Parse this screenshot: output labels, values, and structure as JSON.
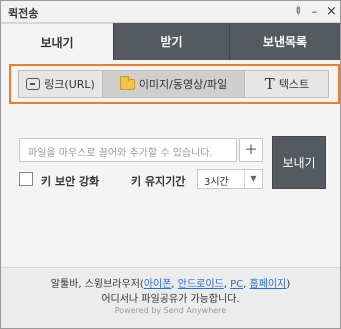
{
  "window": {
    "title": "퀵전송"
  },
  "tabs": [
    {
      "label": "보내기",
      "active": true
    },
    {
      "label": "받기",
      "active": false
    },
    {
      "label": "보낸목록",
      "active": false
    }
  ],
  "modes": [
    {
      "label": "링크(URL)",
      "icon": "link-icon",
      "selected": false
    },
    {
      "label": "이미지/동영상/파일",
      "icon": "folder-icon",
      "selected": true
    },
    {
      "label": "텍스트",
      "icon": "text-icon",
      "selected": false
    }
  ],
  "mode_highlight_color": "#f47a2e",
  "drop": {
    "placeholder": "파일을 마우스로 끌어와 추가할 수 있습니다.",
    "add_label": "+"
  },
  "send_label": "보내기",
  "options": {
    "key_security_label": "키 보안 강화",
    "key_period_label": "키 유지기간",
    "key_period_value": "3시간"
  },
  "footer": {
    "line1_prefix": "알툴바, 스윙브라우저(",
    "links": [
      "아이폰",
      "안드로이드",
      "PC",
      "홈페이지"
    ],
    "line1_suffix": ")",
    "line2": "어디서나 파일공유가 가능합니다.",
    "powered": "Powered by Send Anywhere"
  },
  "colors": {
    "tab_dark": "#555a61",
    "link": "#2a6fd6"
  }
}
